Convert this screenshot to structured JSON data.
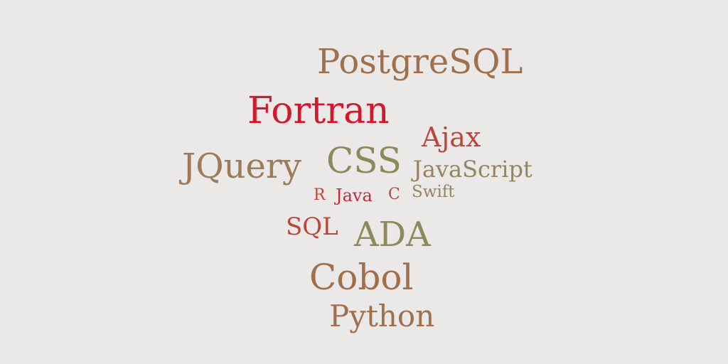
{
  "words": [
    {
      "text": "PostgreSQL",
      "color": "#a0704d"
    },
    {
      "text": "Fortran",
      "color": "#d01a2c"
    },
    {
      "text": "Ajax",
      "color": "#b8473d"
    },
    {
      "text": "JQuery",
      "color": "#9c7b58"
    },
    {
      "text": "CSS",
      "color": "#8c8a5c"
    },
    {
      "text": "JavaScript",
      "color": "#948460"
    },
    {
      "text": "R",
      "color": "#b8473d"
    },
    {
      "text": "Java",
      "color": "#c4293a"
    },
    {
      "text": "C",
      "color": "#b8473d"
    },
    {
      "text": "Swift",
      "color": "#948460"
    },
    {
      "text": "SQL",
      "color": "#b8473d"
    },
    {
      "text": "ADA",
      "color": "#8c8a5c"
    },
    {
      "text": "Cobol",
      "color": "#a0704d"
    },
    {
      "text": "Python",
      "color": "#a0704d"
    }
  ]
}
